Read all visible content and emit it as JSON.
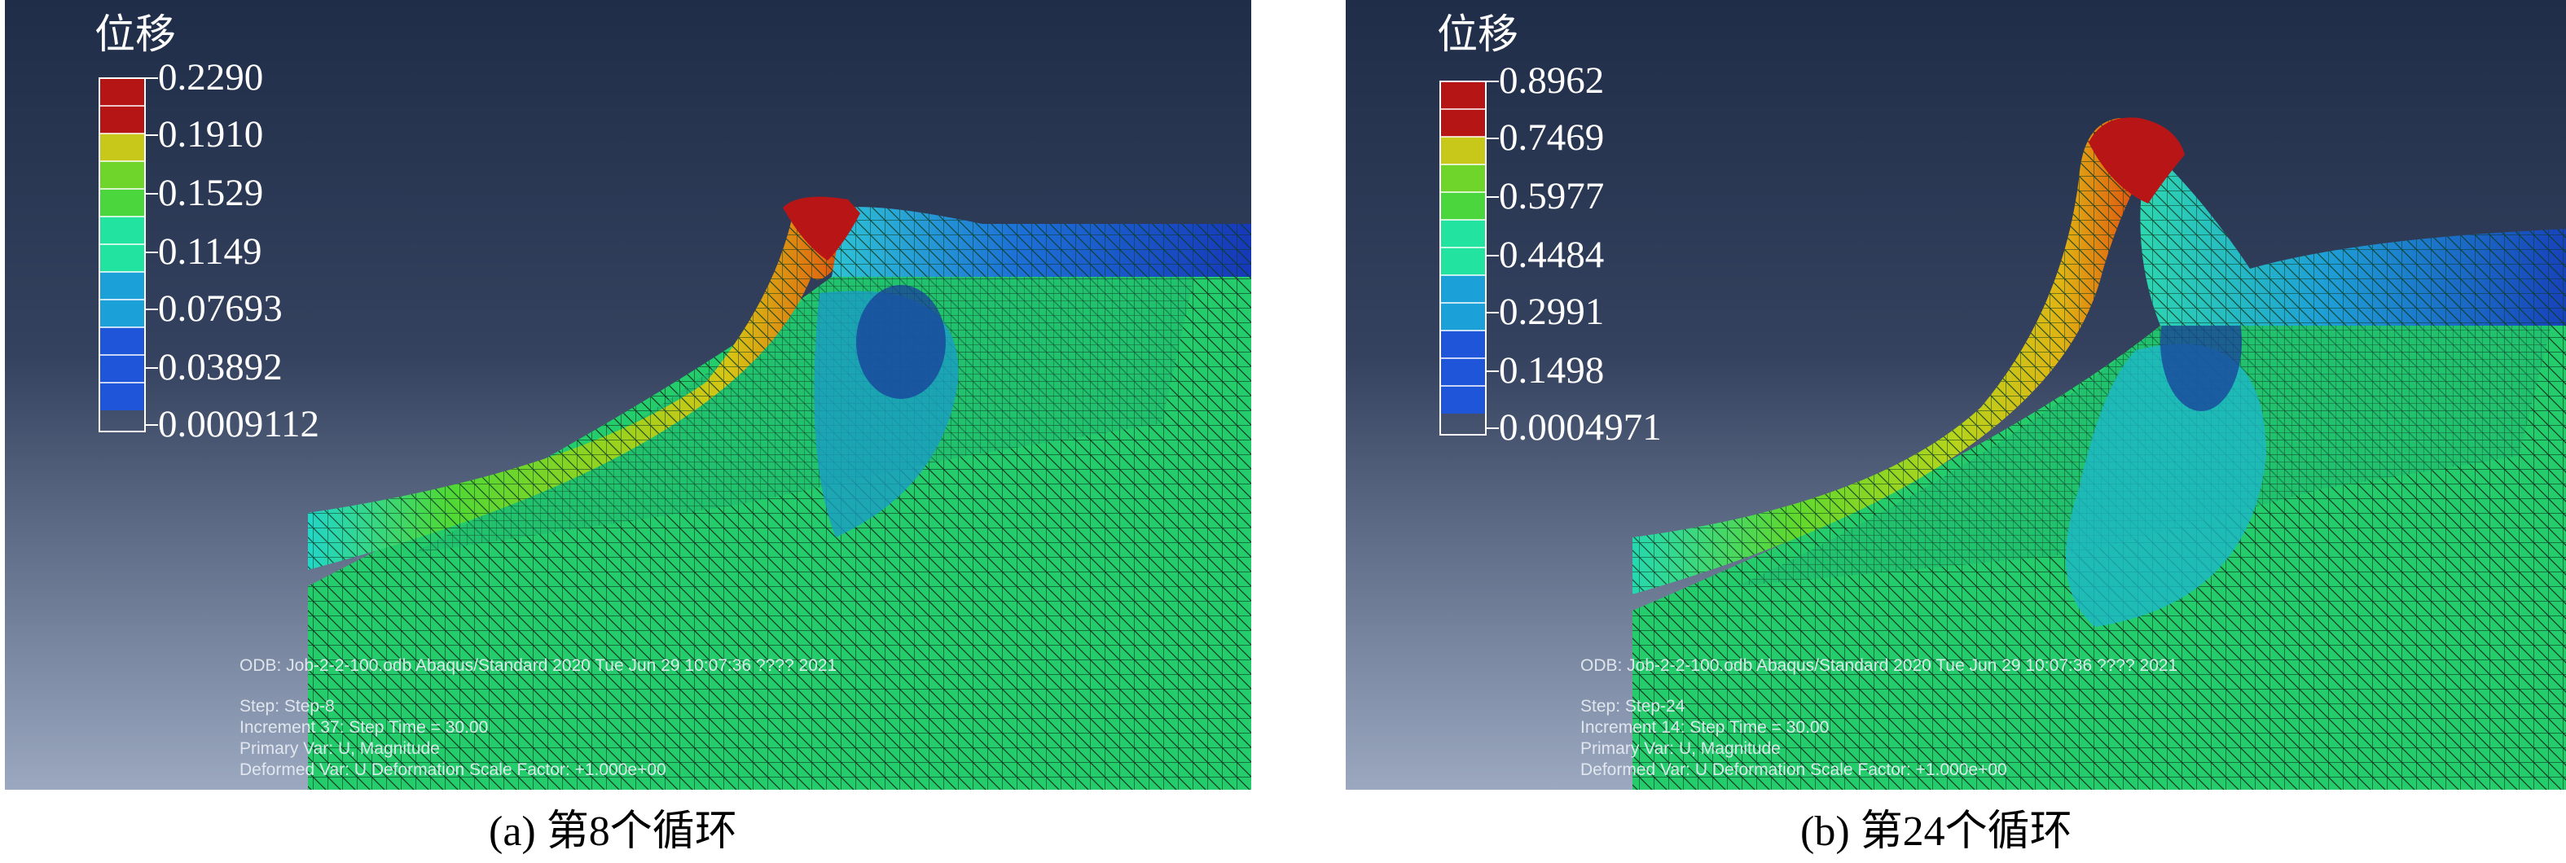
{
  "panels": [
    {
      "legend_title": "位移",
      "legend_values": [
        "0.2290",
        "0.1910",
        "0.1529",
        "0.1149",
        "0.07693",
        "0.03892",
        "0.0009112"
      ],
      "info": {
        "odb": "ODB: Job-2-2-100.odb    Abaqus/Standard 2020    Tue Jun 29 10:07:36 ???? 2021",
        "step": "Step: Step-8",
        "increment": "Increment     37: Step Time =    30.00",
        "primary_var": "Primary Var: U, Magnitude",
        "deformed_var": "Deformed Var: U   Deformation Scale Factor: +1.000e+00"
      },
      "caption": "(a) 第8个循环"
    },
    {
      "legend_title": "位移",
      "legend_values": [
        "0.8962",
        "0.7469",
        "0.5977",
        "0.4484",
        "0.2991",
        "0.1498",
        "0.0004971"
      ],
      "info": {
        "odb": "ODB: Job-2-2-100.odb    Abaqus/Standard 2020    Tue Jun 29 10:07:36 ???? 2021",
        "step": "Step: Step-24",
        "increment": "Increment     14: Step Time =    30.00",
        "primary_var": "Primary Var: U, Magnitude",
        "deformed_var": "Deformed Var: U   Deformation Scale Factor: +1.000e+00"
      },
      "caption": "(b) 第24个循环"
    }
  ],
  "colors": {
    "legend": [
      "#b51515",
      "#b51515",
      "#c8c81a",
      "#6fd52a",
      "#4cd63d",
      "#22e3a0",
      "#1ca0d8",
      "#1f55d9"
    ],
    "bg_top": "#1f2d48",
    "bg_bottom": "#9aa7bf",
    "base_green": "#24cc6c"
  }
}
